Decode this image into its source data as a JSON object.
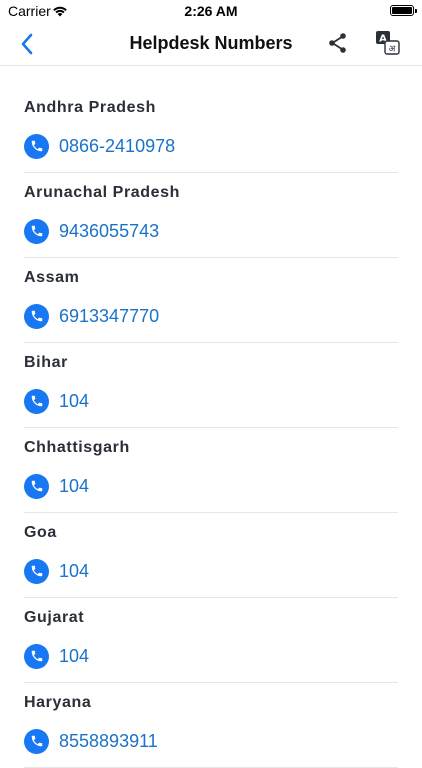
{
  "status_bar": {
    "carrier": "Carrier",
    "time": "2:26 AM"
  },
  "nav": {
    "title": "Helpdesk Numbers",
    "back_icon": "chevron-left-icon",
    "share_icon": "share-icon",
    "translate_icon": "translate-icon"
  },
  "colors": {
    "accent": "#1877f2",
    "link": "#1a73c8"
  },
  "helplines": [
    {
      "state": "Andhra Pradesh",
      "number": "0866-2410978"
    },
    {
      "state": "Arunachal Pradesh",
      "number": "9436055743"
    },
    {
      "state": "Assam",
      "number": "6913347770"
    },
    {
      "state": "Bihar",
      "number": "104"
    },
    {
      "state": "Chhattisgarh",
      "number": "104"
    },
    {
      "state": "Goa",
      "number": "104"
    },
    {
      "state": "Gujarat",
      "number": "104"
    },
    {
      "state": "Haryana",
      "number": "8558893911"
    }
  ]
}
